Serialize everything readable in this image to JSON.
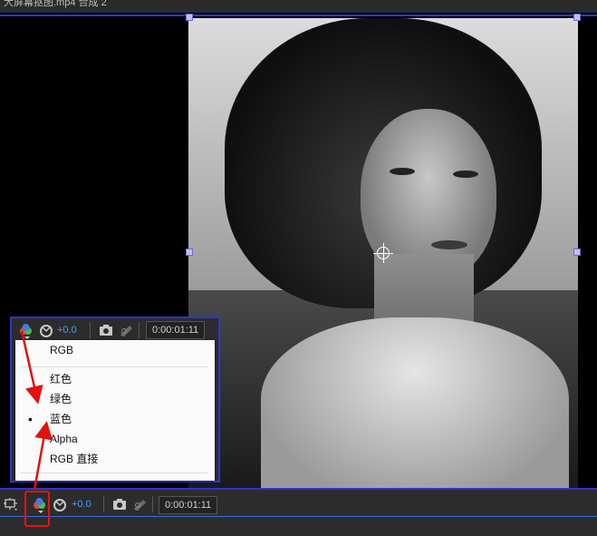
{
  "window": {
    "title": "大屏幕抠图.mp4 合成 2"
  },
  "viewer": {
    "background": "#000000",
    "selection_color": "#2d34d9"
  },
  "toolbar": {
    "exposure_value": "+0.0",
    "timecode": "0:00:01:11",
    "icons": [
      "region-of-interest-icon",
      "channel-icon",
      "exposure-reset-icon",
      "snapshot-icon",
      "show-snapshot-icon"
    ]
  },
  "popup_toolbar": {
    "exposure_value": "+0.0",
    "timecode": "0:00:01:11"
  },
  "channel_menu": {
    "items": [
      {
        "label": "RGB",
        "checked": false
      },
      {
        "label": "红色",
        "checked": false
      },
      {
        "label": "绿色",
        "checked": false
      },
      {
        "label": "蓝色",
        "checked": true
      },
      {
        "label": "Alpha",
        "checked": false
      },
      {
        "label": "RGB 直接",
        "checked": false
      }
    ],
    "check_mark": "•"
  },
  "annotations": {
    "color": "#e11111"
  }
}
